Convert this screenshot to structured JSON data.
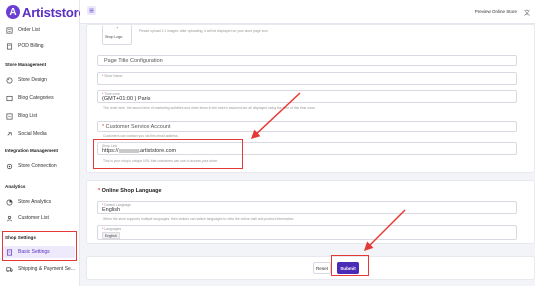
{
  "brand": {
    "logo_text": "Artiststore",
    "logo_letter": "A"
  },
  "topbar": {
    "preview_label": "Preview Online Store"
  },
  "sidebar": {
    "items_top": [
      {
        "label": "Order List",
        "icon": "order-list-icon"
      },
      {
        "label": "POD Billing",
        "icon": "billing-icon"
      }
    ],
    "store_management": {
      "title": "Store Management",
      "items": [
        {
          "label": "Store Design",
          "icon": "palette-icon"
        },
        {
          "label": "Blog Categories",
          "icon": "blog-categories-icon"
        },
        {
          "label": "Blog List",
          "icon": "blog-list-icon"
        },
        {
          "label": "Social Media",
          "icon": "link-icon"
        }
      ]
    },
    "integration": {
      "title": "Integration Management",
      "items": [
        {
          "label": "Store Connection",
          "icon": "gear-icon"
        }
      ]
    },
    "analytics": {
      "title": "Analytics",
      "items": [
        {
          "label": "Store Analytics",
          "icon": "analytics-icon"
        },
        {
          "label": "Customer List",
          "icon": "people-icon"
        }
      ]
    },
    "shop_settings": {
      "title": "Shop Settings",
      "items": [
        {
          "label": "Basic Settings",
          "icon": "settings-doc-icon"
        },
        {
          "label": "Shipping & Payment Se...",
          "icon": "truck-icon"
        }
      ]
    }
  },
  "logo_upload": {
    "shop_logo_label": "Shop Logo",
    "hint": "Please upload 1:1 images, after uploading, it will be displayed on your store page icon"
  },
  "page_title_config": {
    "title": "Page Title Configuration",
    "store_name_label": "Store Name",
    "time_zone_label": "Time zone",
    "time_zone_value": "(GMT+01:00 ) Paris",
    "time_zone_hint": "The order time, the launch time of marketing activities and other times in the store's backend are all displayed using the time of this time zone."
  },
  "customer_service": {
    "title": "Customer Service Account",
    "hint": "Customers can contact you via this email address."
  },
  "shop_link": {
    "label": "Shop Link",
    "prefix": "https://",
    "suffix": ".artiststore.com",
    "hint": "This is your shop's unique URL that customers can use to access your store."
  },
  "online_language": {
    "title": "Online Shop Language",
    "default_label": "Default Language",
    "default_value": "English",
    "hint": "When the store supports multiple languages, then visitors can switch languages to view the online mall and product information.",
    "languages_label": "Languages",
    "language_tag": "English"
  },
  "actions": {
    "reset_label": "Reset",
    "submit_label": "Submit"
  },
  "colors": {
    "brand": "#5b2fc4",
    "submit": "#4a2bb5",
    "annotation": "#e53935"
  }
}
